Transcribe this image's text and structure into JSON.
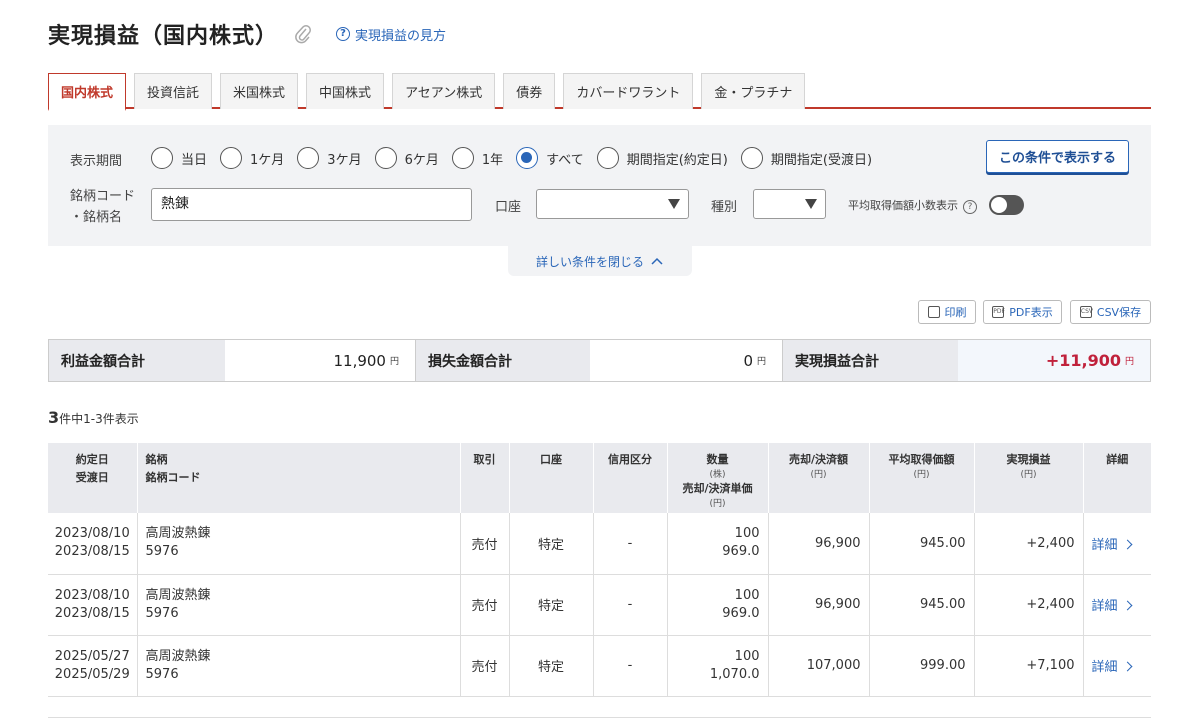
{
  "header": {
    "title": "実現損益（国内株式）",
    "help_link": "実現損益の見方"
  },
  "tabs": [
    {
      "label": "国内株式",
      "active": true
    },
    {
      "label": "投資信託"
    },
    {
      "label": "米国株式"
    },
    {
      "label": "中国株式"
    },
    {
      "label": "アセアン株式"
    },
    {
      "label": "債券"
    },
    {
      "label": "カバードワラント"
    },
    {
      "label": "金・プラチナ"
    }
  ],
  "filters": {
    "period_label": "表示期間",
    "period_options": [
      "当日",
      "1ケ月",
      "3ケ月",
      "6ケ月",
      "1年",
      "すべて",
      "期間指定(約定日)",
      "期間指定(受渡日)"
    ],
    "period_selected": "すべて",
    "apply_label": "この条件で表示する",
    "code_label_line1": "銘柄コード",
    "code_label_line2": "・銘柄名",
    "code_value": "熱錬",
    "account_label": "口座",
    "account_value": "",
    "type_label": "種別",
    "type_value": "",
    "decimal_label": "平均取得価額小数表示",
    "decimal_toggle_on": false,
    "collapse_label": "詳しい条件を閉じる"
  },
  "tools": {
    "print": "印刷",
    "pdf": "PDF表示",
    "csv": "CSV保存"
  },
  "summary": {
    "profit_label": "利益金額合計",
    "profit_value": "11,900",
    "loss_label": "損失金額合計",
    "loss_value": "0",
    "total_label": "実現損益合計",
    "total_value": "+11,900",
    "unit": "円"
  },
  "count": {
    "total": "3",
    "text": "件中1-3件表示"
  },
  "table": {
    "headers": {
      "date1": "約定日",
      "date2": "受渡日",
      "name1": "銘柄",
      "name2": "銘柄コード",
      "trade": "取引",
      "account": "口座",
      "margin": "信用区分",
      "qty": "数量",
      "qty_unit": "(株)",
      "price": "売却/決済単価",
      "price_unit": "(円)",
      "amount": "売却/決済額",
      "amount_unit": "(円)",
      "avg": "平均取得価額",
      "avg_unit": "(円)",
      "pl": "実現損益",
      "pl_unit": "(円)",
      "detail": "詳細"
    },
    "rows": [
      {
        "trade_date": "2023/08/10",
        "settle_date": "2023/08/15",
        "name": "高周波熱錬",
        "code": "5976",
        "trade": "売付",
        "account": "特定",
        "margin": "-",
        "qty": "100",
        "price": "969.0",
        "amount": "96,900",
        "avg": "945.00",
        "pl": "+2,400",
        "detail": "詳細"
      },
      {
        "trade_date": "2023/08/10",
        "settle_date": "2023/08/15",
        "name": "高周波熱錬",
        "code": "5976",
        "trade": "売付",
        "account": "特定",
        "margin": "-",
        "qty": "100",
        "price": "969.0",
        "amount": "96,900",
        "avg": "945.00",
        "pl": "+2,400",
        "detail": "詳細"
      },
      {
        "trade_date": "2025/05/27",
        "settle_date": "2025/05/29",
        "name": "高周波熱錬",
        "code": "5976",
        "trade": "売付",
        "account": "特定",
        "margin": "-",
        "qty": "100",
        "price": "1,070.0",
        "amount": "107,000",
        "avg": "999.00",
        "pl": "+7,100",
        "detail": "詳細"
      }
    ]
  },
  "colors": {
    "accent_red": "#c0392b",
    "link_blue": "#2a66b8",
    "profit_red": "#c0213b"
  }
}
